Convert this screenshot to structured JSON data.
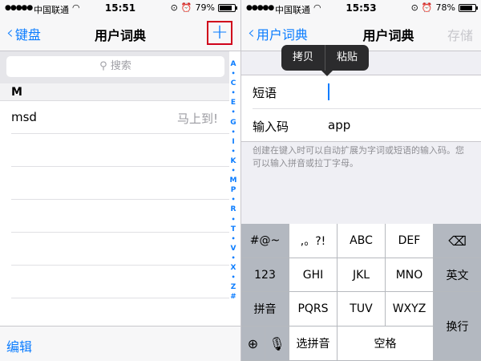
{
  "left": {
    "status": {
      "carrier": "中国联通",
      "time": "15:51",
      "battery": "79%",
      "battery_level": 0.79
    },
    "nav": {
      "back_label": "键盘",
      "title": "用户词典",
      "add_label": "+"
    },
    "search": {
      "placeholder": "搜索"
    },
    "section_header": "M",
    "entries": [
      {
        "term": "msd",
        "shortcut": "马上到!"
      }
    ],
    "index": [
      "A",
      "•",
      "C",
      "•",
      "E",
      "•",
      "G",
      "•",
      "I",
      "•",
      "K",
      "•",
      "M",
      "P",
      "•",
      "R",
      "•",
      "T",
      "•",
      "V",
      "•",
      "X",
      "•",
      "Z",
      "#"
    ],
    "toolbar": {
      "edit_label": "编辑"
    }
  },
  "right": {
    "status": {
      "carrier": "中国联通",
      "time": "15:53",
      "battery": "78%",
      "battery_level": 0.78
    },
    "nav": {
      "back_label": "用户词典",
      "title": "用户词典",
      "save_label": "存储"
    },
    "popup": {
      "copy": "拷贝",
      "paste": "粘贴"
    },
    "fields": {
      "phrase_label": "短语",
      "phrase_value": "",
      "shortcut_label": "输入码",
      "shortcut_value": "app"
    },
    "hint": "创建在键入时可以自动扩展为字词或短语的输入码。您可以输入拼音或拉丁字母。",
    "keyboard": {
      "row1": [
        "#@~",
        ",。?!",
        "ABC",
        "DEF"
      ],
      "row2": [
        "123",
        "GHI",
        "JKL",
        "MNO",
        "英文"
      ],
      "row3": [
        "拼音",
        "PQRS",
        "TUV",
        "WXYZ"
      ],
      "row4": [
        "选拼音",
        "空格"
      ],
      "return_label": "换行"
    }
  },
  "colors": {
    "accent": "#0a7cff",
    "highlight_border": "#d0021b"
  }
}
